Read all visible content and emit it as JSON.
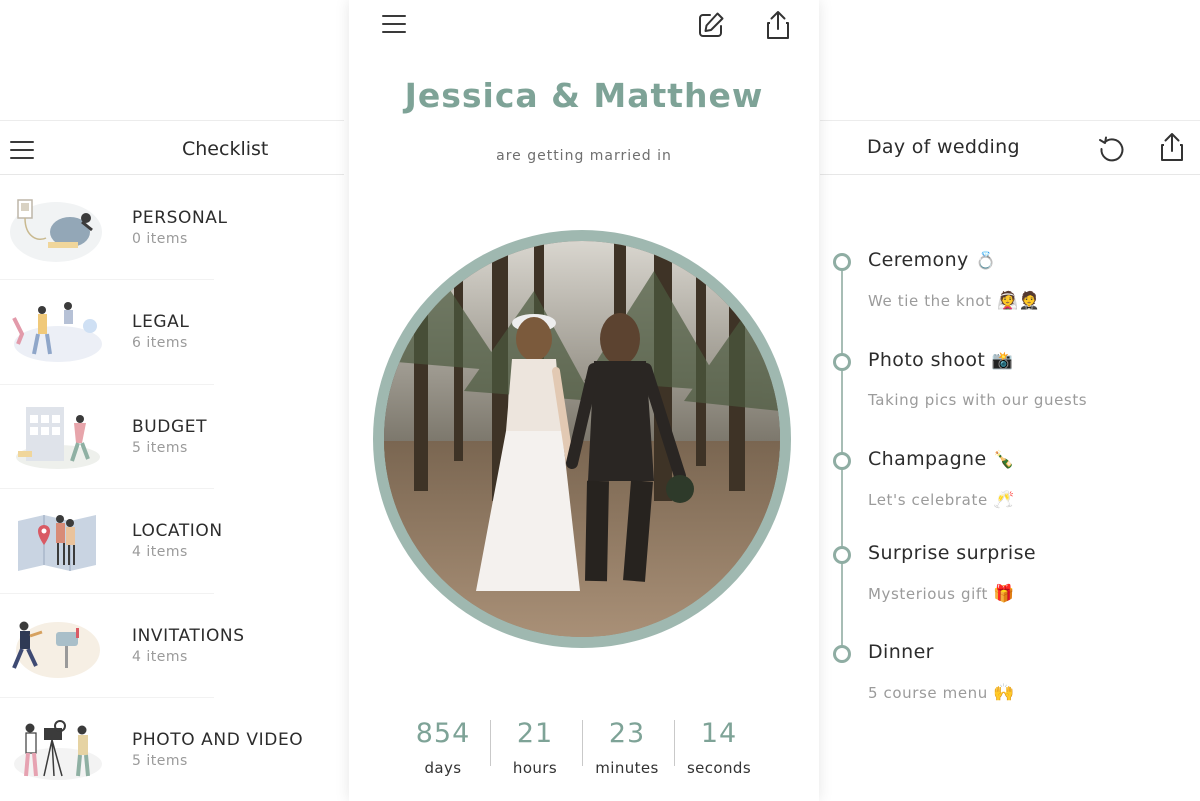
{
  "checklist": {
    "title": "Checklist",
    "categories": [
      {
        "name": "PERSONAL",
        "count": "0 items"
      },
      {
        "name": "LEGAL",
        "count": "6 items"
      },
      {
        "name": "BUDGET",
        "count": "5 items"
      },
      {
        "name": "LOCATION",
        "count": "4 items"
      },
      {
        "name": "INVITATIONS",
        "count": "4 items"
      },
      {
        "name": "PHOTO AND VIDEO",
        "count": "5 items"
      }
    ]
  },
  "countdown": {
    "names": "Jessica & Matthew",
    "subtitle": "are getting married in",
    "units": [
      {
        "value": "854",
        "label": "days"
      },
      {
        "value": "21",
        "label": "hours"
      },
      {
        "value": "23",
        "label": "minutes"
      },
      {
        "value": "14",
        "label": "seconds"
      }
    ],
    "accent_color": "#7ea397"
  },
  "day_of_wedding": {
    "title": "Day of wedding",
    "events": [
      {
        "title": "Ceremony",
        "title_emoji": "💍",
        "subtitle": "We tie the knot",
        "subtitle_emoji": "👰🤵"
      },
      {
        "title": "Photo shoot",
        "title_emoji": "📸",
        "subtitle": "Taking pics with our guests",
        "subtitle_emoji": ""
      },
      {
        "title": "Champagne",
        "title_emoji": "🍾",
        "subtitle": "Let's celebrate",
        "subtitle_emoji": "🥂"
      },
      {
        "title": "Surprise surprise",
        "title_emoji": "",
        "subtitle": "Mysterious gift",
        "subtitle_emoji": "🎁"
      },
      {
        "title": "Dinner",
        "title_emoji": "",
        "subtitle": "5 course menu",
        "subtitle_emoji": "🙌"
      }
    ]
  },
  "icons": {
    "menu": "menu-icon",
    "edit": "edit-icon",
    "share": "share-icon",
    "refresh": "refresh-icon"
  }
}
